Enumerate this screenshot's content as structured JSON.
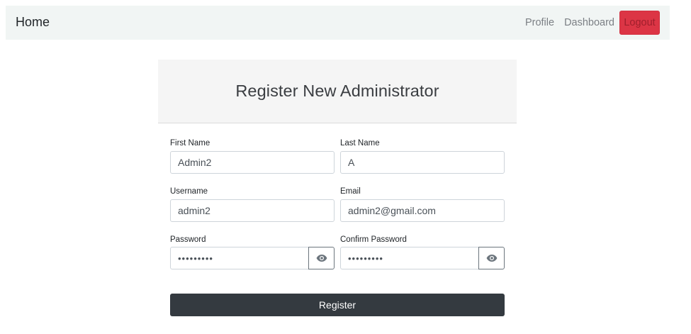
{
  "navbar": {
    "brand": "Home",
    "links": [
      "Profile",
      "Dashboard"
    ],
    "logout_label": "Logout"
  },
  "card": {
    "title": "Register New Administrator"
  },
  "form": {
    "first_name": {
      "label": "First Name",
      "value": "Admin2"
    },
    "last_name": {
      "label": "Last Name",
      "value": "A"
    },
    "username": {
      "label": "Username",
      "value": "admin2"
    },
    "email": {
      "label": "Email",
      "value": "admin2@gmail.com"
    },
    "password": {
      "label": "Password",
      "value": "•••••••••"
    },
    "confirm_password": {
      "label": "Confirm Password",
      "value": "•••••••••"
    },
    "submit_label": "Register"
  },
  "colors": {
    "navbar_bg": "#f1f5f4",
    "logout_bg": "#dc3545",
    "register_bg": "#343a40",
    "header_bg": "#f5f5f5"
  },
  "icons": {
    "password_toggle": "eye-icon",
    "confirm_password_toggle": "eye-icon"
  }
}
